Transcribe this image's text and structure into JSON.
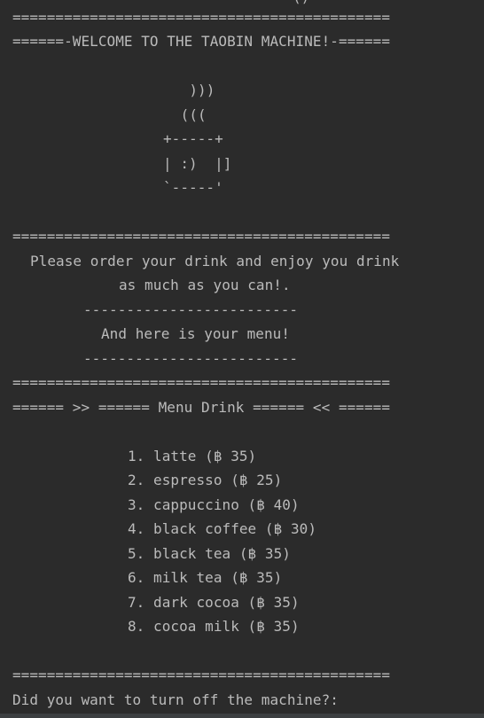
{
  "console": {
    "top_partial": "()",
    "separator": "============================================",
    "welcome": "======-WELCOME TO THE TAOBIN MACHINE!-======",
    "art": [
      "  )))",
      " (((",
      "+-----+",
      "| :)  |]",
      "`-----'"
    ],
    "intro_1": "Please order your drink and enjoy you drink",
    "intro_2": "as much as you can!.",
    "dashes": "-------------------------",
    "menu_intro": "And here is your menu!",
    "menu_header": "====== >> ====== Menu Drink ====== << ======",
    "menu_items": [
      "1. latte (฿ 35)",
      "2. espresso (฿ 25)",
      "3. cappuccino (฿ 40)",
      "4. black coffee (฿ 30)",
      "5. black tea (฿ 35)",
      "6. milk tea (฿ 35)",
      "7. dark cocoa (฿ 35)",
      "8. cocoa milk (฿ 35)"
    ],
    "prompt": "Did you want to turn off the machine?:"
  }
}
